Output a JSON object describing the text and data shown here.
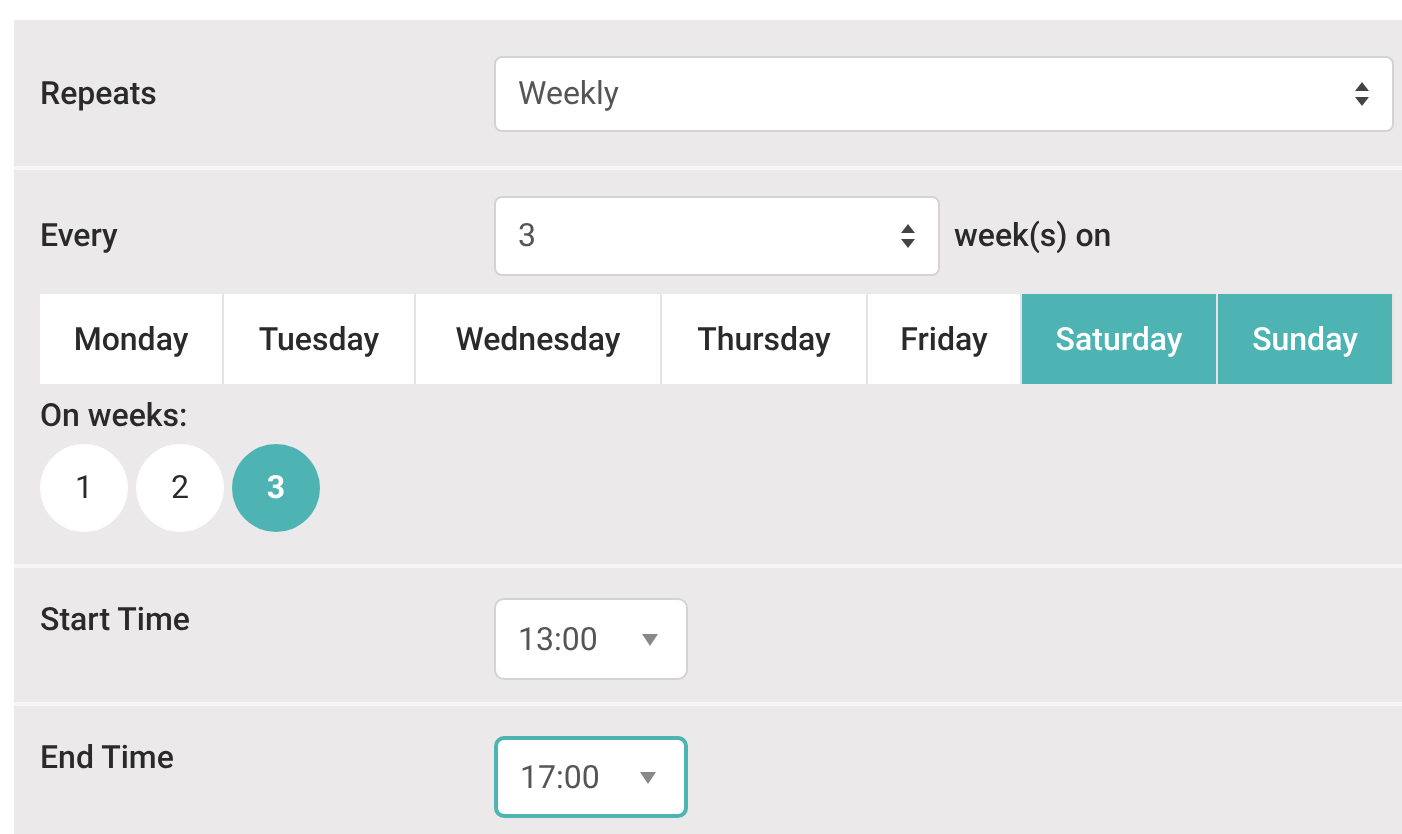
{
  "repeats": {
    "label": "Repeats",
    "value": "Weekly"
  },
  "every": {
    "label": "Every",
    "value": "3",
    "suffix": "week(s) on"
  },
  "days": [
    {
      "label": "Monday",
      "selected": false
    },
    {
      "label": "Tuesday",
      "selected": false
    },
    {
      "label": "Wednesday",
      "selected": false
    },
    {
      "label": "Thursday",
      "selected": false
    },
    {
      "label": "Friday",
      "selected": false
    },
    {
      "label": "Saturday",
      "selected": true
    },
    {
      "label": "Sunday",
      "selected": true
    }
  ],
  "on_weeks": {
    "label": "On weeks:",
    "weeks": [
      {
        "label": "1",
        "selected": false
      },
      {
        "label": "2",
        "selected": false
      },
      {
        "label": "3",
        "selected": true
      }
    ]
  },
  "times": [
    {
      "label": "Start Time",
      "value": "13:00",
      "focused": false
    },
    {
      "label": "End Time",
      "value": "17:00",
      "focused": true
    }
  ]
}
